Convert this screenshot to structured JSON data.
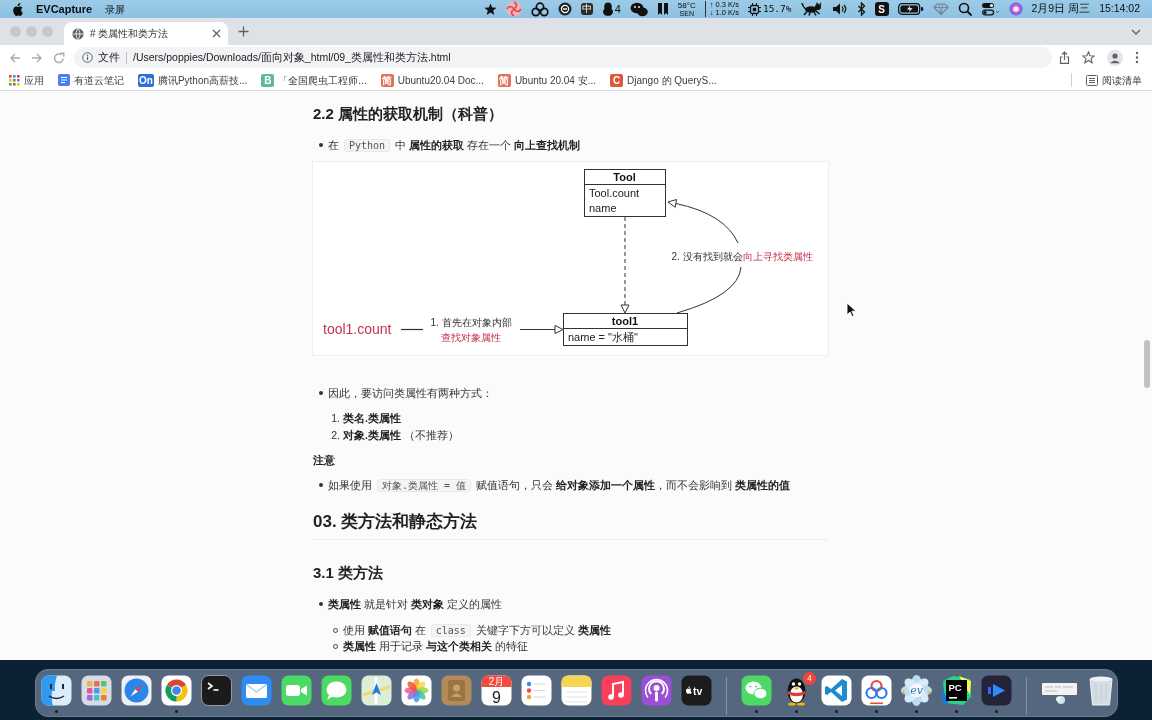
{
  "menu_bar": {
    "app_name": "EVCapture",
    "menus": [
      "录屏"
    ],
    "status_items": [
      {
        "kind": "star"
      },
      {
        "kind": "swirl"
      },
      {
        "kind": "circles"
      },
      {
        "kind": "ring"
      },
      {
        "kind": "input",
        "label": "中"
      },
      {
        "kind": "penguin",
        "count": "4"
      },
      {
        "kind": "bubbles"
      },
      {
        "kind": "bookmark"
      },
      {
        "kind": "sensor",
        "value": "58°C",
        "caption": "SEN"
      },
      {
        "kind": "network",
        "upload": "↑ 0.3 K/s",
        "download": "↓ 1.0 K/s"
      },
      {
        "kind": "cpu",
        "value": "15.7%"
      },
      {
        "kind": "cat"
      },
      {
        "kind": "volume"
      },
      {
        "kind": "bluetooth"
      },
      {
        "kind": "tile",
        "label": "S"
      },
      {
        "kind": "battery"
      },
      {
        "kind": "gem"
      },
      {
        "kind": "search"
      },
      {
        "kind": "toggles"
      },
      {
        "kind": "orb"
      }
    ],
    "date": "2月9日 周三",
    "time": "15:14:02"
  },
  "browser": {
    "tabs": [
      {
        "title": "# 类属性和类方法",
        "selected": true
      }
    ],
    "address": {
      "scheme": "文件",
      "url": "/Users/poppies/Downloads/面向对象_html/09_类属性和类方法.html"
    },
    "bookmarks": [
      {
        "kind": "grid",
        "label": "应用"
      },
      {
        "kind": "note",
        "label": "有道云笔记"
      },
      {
        "kind": "letter",
        "icon_text": "On",
        "color": "#2f6fd8",
        "label": "腾讯Python高薪技..."
      },
      {
        "kind": "letter",
        "icon_text": "B",
        "color": "#5fb9a2",
        "label": "「全国爬虫工程师..."
      },
      {
        "kind": "letter",
        "icon_text": "简",
        "color": "#e27058",
        "label": "Ubuntu20.04 Doc..."
      },
      {
        "kind": "letter",
        "icon_text": "简",
        "color": "#e27058",
        "label": "Ubuntu 20.04 安..."
      },
      {
        "kind": "letter",
        "icon_text": "C",
        "color": "#e0553b",
        "label": "Django 的 QueryS..."
      }
    ],
    "reading_list": "阅读清单"
  },
  "article": {
    "blocks": [
      {
        "kind": "h3",
        "text": "2.2 属性的获取机制（科普）"
      },
      {
        "kind": "bullet",
        "parts": [
          {
            "kind": "text",
            "text": "在 "
          },
          {
            "kind": "code",
            "text": "Python"
          },
          {
            "kind": "text",
            "text": " 中 **属性的获取** 存在一个 **向上查找机制**"
          }
        ]
      },
      {
        "kind": "diagram",
        "nodes": [
          {
            "title": "Tool",
            "fields": [
              "Tool.count",
              "name"
            ]
          },
          {
            "title": "tool1",
            "fields": [
              "name = \"水桶\""
            ]
          }
        ],
        "expression": "tool1.count",
        "steps": [
          {
            "lines": [
              [
                {
                  "text": "1. 首先在对象内部",
                  "highlight": false
                }
              ],
              [
                {
                  "text": "查找对象属性",
                  "highlight": true
                }
              ]
            ]
          },
          {
            "lines": [
              [
                {
                  "text": "2. 没有找到就会",
                  "highlight": false
                },
                {
                  "text": "向上寻找类属性",
                  "highlight": true
                }
              ]
            ]
          }
        ]
      },
      {
        "kind": "bullet",
        "parts": [
          {
            "kind": "text",
            "text": "因此，要访问类属性有两种方式："
          }
        ]
      },
      {
        "kind": "numbered",
        "number": "1.",
        "parts": [
          {
            "kind": "text",
            "text": "**类名.类属性**"
          }
        ]
      },
      {
        "kind": "numbered",
        "number": "2.",
        "parts": [
          {
            "kind": "text",
            "text": "**对象.类属性** （不推荐）"
          }
        ]
      },
      {
        "kind": "label",
        "text": "注意"
      },
      {
        "kind": "bullet",
        "parts": [
          {
            "kind": "text",
            "text": "如果使用 "
          },
          {
            "kind": "code",
            "text": "对象.类属性 = 值"
          },
          {
            "kind": "text",
            "text": " 赋值语句，只会 **给对象添加一个属性**，而不会影响到 **类属性的值**"
          }
        ]
      },
      {
        "kind": "h2",
        "text": "03. 类方法和静态方法"
      },
      {
        "kind": "h3",
        "text": "3.1 类方法"
      },
      {
        "kind": "bullet",
        "parts": [
          {
            "kind": "text",
            "text": "**类属性** 就是针对 **类对象** 定义的属性"
          }
        ]
      },
      {
        "kind": "subbullet",
        "parts": [
          {
            "kind": "text",
            "text": "使用 **赋值语句** 在 "
          },
          {
            "kind": "code",
            "text": "class"
          },
          {
            "kind": "text",
            "text": " 关键字下方可以定义 **类属性**"
          }
        ]
      },
      {
        "kind": "subbullet",
        "parts": [
          {
            "kind": "text",
            "text": "**类属性** 用于记录 **与这个类相关** 的特征"
          }
        ]
      }
    ]
  },
  "dock": {
    "groups": [
      {
        "items": [
          {
            "kind": "finder",
            "running": true
          },
          {
            "kind": "launcher",
            "running": false
          },
          {
            "kind": "compass",
            "running": false
          },
          {
            "kind": "browser",
            "running": true
          },
          {
            "kind": "terminal",
            "running": false
          },
          {
            "kind": "mail",
            "running": false
          },
          {
            "kind": "video",
            "running": false
          },
          {
            "kind": "messages",
            "running": false
          },
          {
            "kind": "maps",
            "running": false
          },
          {
            "kind": "photos",
            "running": false
          },
          {
            "kind": "contacts",
            "running": false
          },
          {
            "kind": "calendar",
            "month": "2月",
            "day": "9",
            "running": false
          },
          {
            "kind": "reminders",
            "running": false
          },
          {
            "kind": "notes",
            "running": false
          },
          {
            "kind": "music",
            "running": false
          },
          {
            "kind": "podcasts",
            "running": false
          },
          {
            "kind": "tv",
            "label": "tv",
            "running": false
          }
        ]
      },
      {
        "items": [
          {
            "kind": "wechat",
            "running": true
          },
          {
            "kind": "penguin",
            "badge": "4",
            "running": true
          },
          {
            "kind": "editor",
            "running": true
          },
          {
            "kind": "cloud",
            "running": true
          },
          {
            "kind": "flower",
            "label": "ev",
            "running": true
          },
          {
            "kind": "ide",
            "label": "PC",
            "running": true
          },
          {
            "kind": "player",
            "running": true
          }
        ]
      },
      {
        "items": [
          {
            "kind": "thumbnail"
          },
          {
            "kind": "trash"
          }
        ]
      }
    ]
  }
}
